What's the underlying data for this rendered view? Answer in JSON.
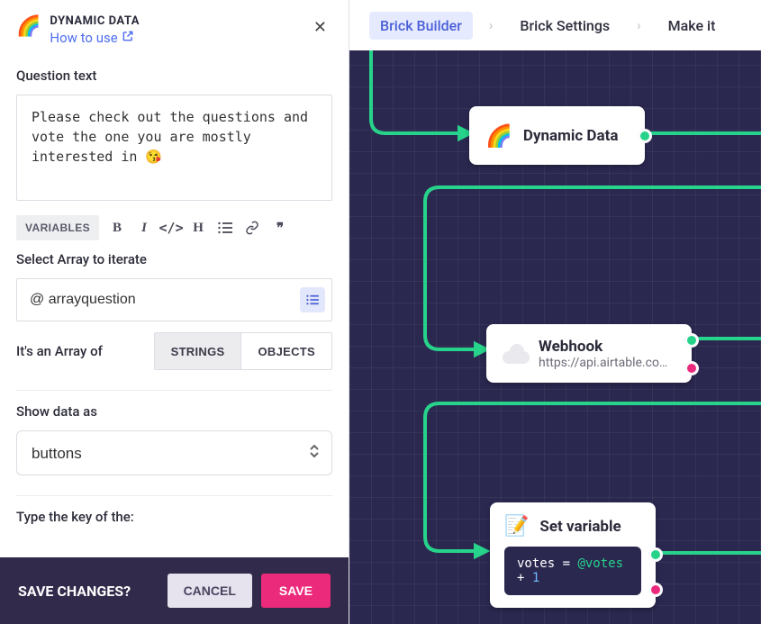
{
  "sidebar": {
    "title": "DYNAMIC DATA",
    "how_to_use": "How to use",
    "question_label": "Question text",
    "question_text": "Please check out the questions and vote the one you are mostly interested in 😘",
    "variables_btn": "VARIABLES",
    "select_array_label": "Select Array to iterate",
    "select_array_value": "@ arrayquestion",
    "array_of_label": "It's an Array of",
    "seg_strings": "STRINGS",
    "seg_objects": "OBJECTS",
    "show_as_label": "Show data as",
    "show_as_value": "buttons",
    "key_label": "Type the key of the:"
  },
  "footer": {
    "question": "SAVE CHANGES?",
    "cancel": "CANCEL",
    "save": "SAVE"
  },
  "breadcrumbs": {
    "builder": "Brick Builder",
    "settings": "Brick Settings",
    "make": "Make it"
  },
  "nodes": {
    "dynamic": {
      "title": "Dynamic Data"
    },
    "webhook": {
      "title": "Webhook",
      "sub": "https://api.airtable.co…"
    },
    "setvar": {
      "title": "Set variable",
      "code_lhs": "votes",
      "code_eq": " = ",
      "code_var": "@votes",
      "code_plus": " + ",
      "code_num": "1"
    }
  }
}
